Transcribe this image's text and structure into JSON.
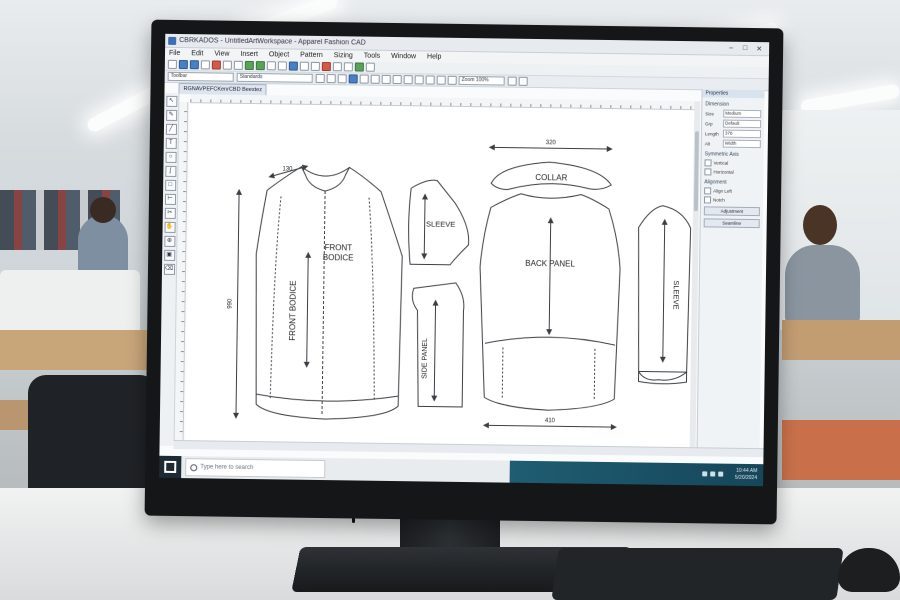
{
  "window": {
    "title": "CBRKADOS - UntitledArtWorkspace - Apparel Fashion CAD"
  },
  "menu": [
    "File",
    "Edit",
    "View",
    "Insert",
    "Object",
    "Pattern",
    "Sizing",
    "Tools",
    "Window",
    "Help"
  ],
  "toolbar2": {
    "style_combo": "Toolbar",
    "font_combo": "Standards",
    "zoom_combo": "Zoom 100%"
  },
  "document_tab": "RGNAVPEFCKenrCBD Beestez",
  "pattern": {
    "dim_width_front": "130",
    "dim_height_front": "990",
    "front_label_top": "FRONT",
    "front_label_bottom": "BODICE",
    "front_vertical_label": "FRONT BODICE",
    "sleeve_small": "SLEEVE",
    "side_panel": "SIDE PANEL",
    "collar_dim": "320",
    "collar": "COLLAR",
    "back_panel": "BACK PANEL",
    "back_dim": "410",
    "sleeve_large": "SLEEVE"
  },
  "properties": {
    "tab": "Properties",
    "head1": "Dimension",
    "rows": [
      {
        "k": "Size",
        "v": "Medium"
      },
      {
        "k": "Grp",
        "v": "Default"
      },
      {
        "k": "Length",
        "v": "378"
      },
      {
        "k": "Alt",
        "v": "Width"
      }
    ],
    "head2": "Symmetric Axis",
    "checks": [
      "Vertical",
      "Horizontal"
    ],
    "head3": "Alignment",
    "checks2": [
      "Align Left",
      "Notch"
    ],
    "buttons": [
      "Adjustment",
      "Seamline"
    ]
  },
  "taskbar": {
    "search_placeholder": "Type here to search",
    "time": "10:44 AM",
    "date": "5/20/2024"
  },
  "colors": {
    "canvas_bg": "#ffffff",
    "pattern_line": "#3b3f44",
    "accent": "#3a6fb5",
    "taskbar_right": "#1f5d72"
  }
}
